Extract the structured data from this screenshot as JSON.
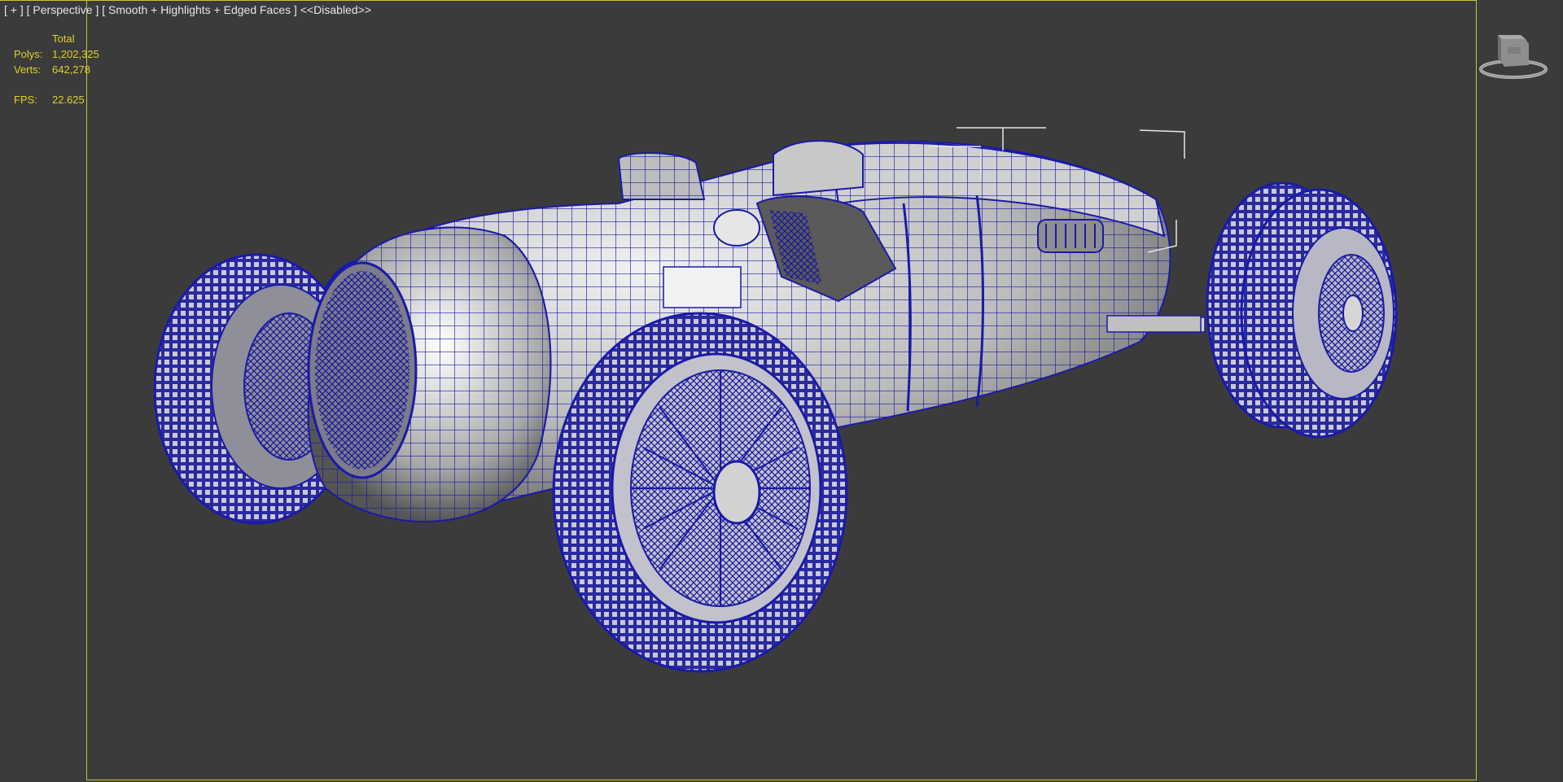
{
  "viewport": {
    "menu_plus": "[ + ]",
    "view_name": "[ Perspective ]",
    "shading_mode": "[ Smooth + Highlights + Edged Faces ]",
    "lighting_state": "<<Disabled>>"
  },
  "stats": {
    "header": "Total",
    "polys_label": "Polys:",
    "polys_value": "1,202,325",
    "verts_label": "Verts:",
    "verts_value": "642,278",
    "fps_label": "FPS:",
    "fps_value": "22.625"
  },
  "colors": {
    "viewport_bg": "#3b3b3b",
    "safe_frame": "#c8c23a",
    "stats_text": "#e0d22a",
    "wireframe": "#1a1aa8",
    "surface": "#d8d8d8"
  },
  "icons": {
    "viewcube": "viewcube-icon"
  }
}
